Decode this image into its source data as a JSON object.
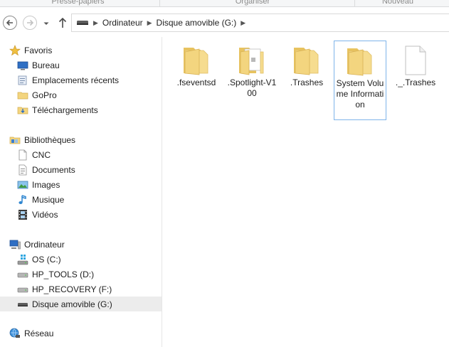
{
  "ribbon": {
    "groups": [
      "Presse-papiers",
      "Organiser",
      "Nouveau"
    ]
  },
  "address": {
    "crumbs": [
      "Ordinateur",
      "Disque amovible (G:)"
    ]
  },
  "nav_pane": {
    "favorites": {
      "label": "Favoris",
      "items": [
        "Bureau",
        "Emplacements récents",
        "GoPro",
        "Téléchargements"
      ]
    },
    "libraries": {
      "label": "Bibliothèques",
      "items": [
        "CNC",
        "Documents",
        "Images",
        "Musique",
        "Vidéos"
      ]
    },
    "computer": {
      "label": "Ordinateur",
      "items": [
        "OS (C:)",
        "HP_TOOLS (D:)",
        "HP_RECOVERY (F:)",
        "Disque amovible (G:)"
      ]
    },
    "network": {
      "label": "Réseau"
    }
  },
  "files": [
    {
      "name": ".fseventsd",
      "type": "folder"
    },
    {
      "name": ".Spotlight-V100",
      "type": "folder-doc"
    },
    {
      "name": ".Trashes",
      "type": "folder"
    },
    {
      "name": "System Volume Information",
      "type": "folder"
    },
    {
      "name": "._.Trashes",
      "type": "file"
    }
  ],
  "colors": {
    "folder": "#f3d57f",
    "selection_border": "#7eb4ea",
    "selected_nav_bg": "#ececec"
  }
}
